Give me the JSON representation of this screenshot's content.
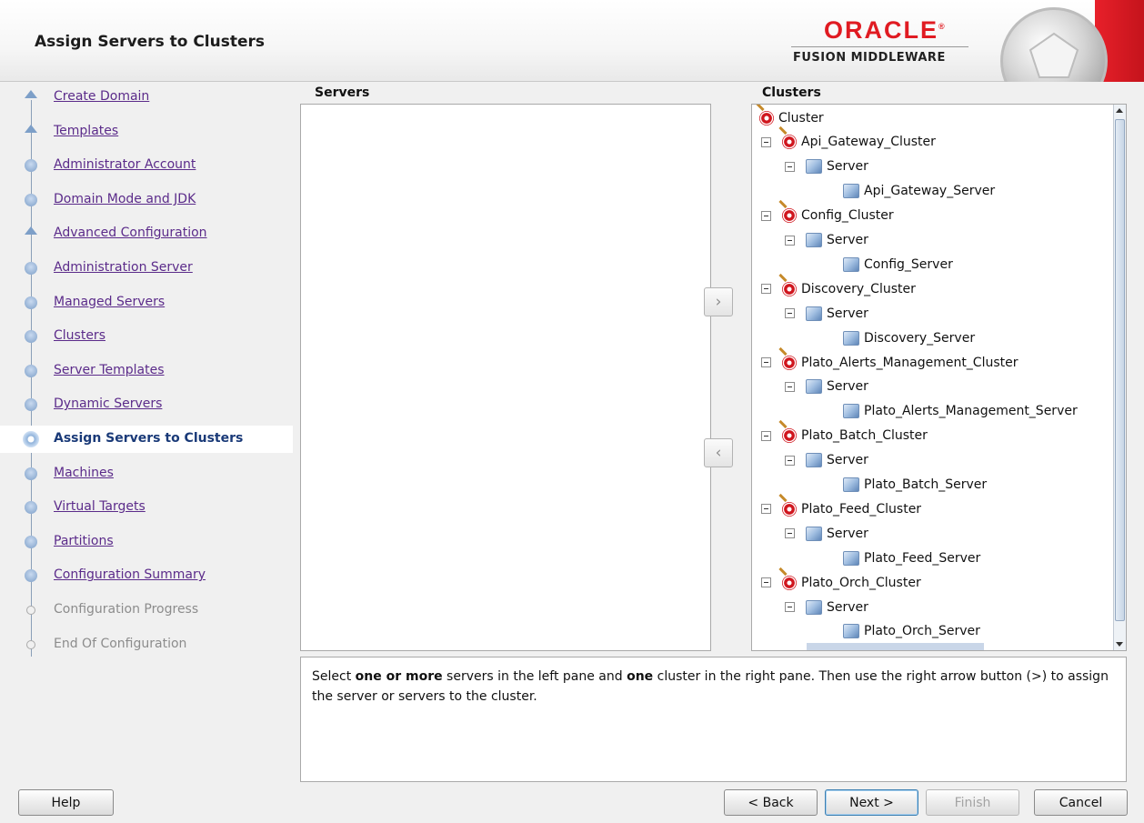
{
  "header": {
    "title": "Assign Servers to Clusters",
    "brand_oracle": "ORACLE",
    "brand_registered": "®",
    "brand_product": "FUSION MIDDLEWARE"
  },
  "nav": {
    "items": [
      {
        "label": "Create Domain",
        "state": "done"
      },
      {
        "label": "Templates",
        "state": "done"
      },
      {
        "label": "Administrator Account",
        "state": "done"
      },
      {
        "label": "Domain Mode and JDK",
        "state": "done"
      },
      {
        "label": "Advanced Configuration",
        "state": "done"
      },
      {
        "label": "Administration Server",
        "state": "done"
      },
      {
        "label": "Managed Servers",
        "state": "done"
      },
      {
        "label": "Clusters",
        "state": "done"
      },
      {
        "label": "Server Templates",
        "state": "done"
      },
      {
        "label": "Dynamic Servers",
        "state": "done"
      },
      {
        "label": "Assign Servers to Clusters",
        "state": "current"
      },
      {
        "label": "Machines",
        "state": "done"
      },
      {
        "label": "Virtual Targets",
        "state": "done"
      },
      {
        "label": "Partitions",
        "state": "done"
      },
      {
        "label": "Configuration Summary",
        "state": "done"
      },
      {
        "label": "Configuration Progress",
        "state": "disabled"
      },
      {
        "label": "End Of Configuration",
        "state": "disabled"
      }
    ]
  },
  "servers_pane": {
    "heading": "Servers",
    "items": []
  },
  "clusters_pane": {
    "heading": "Clusters",
    "tree": [
      {
        "type": "root",
        "label": "Cluster"
      },
      {
        "type": "cluster",
        "label": "Api_Gateway_Cluster"
      },
      {
        "type": "server-group",
        "label": "Server"
      },
      {
        "type": "server",
        "label": "Api_Gateway_Server"
      },
      {
        "type": "cluster",
        "label": "Config_Cluster"
      },
      {
        "type": "server-group",
        "label": "Server"
      },
      {
        "type": "server",
        "label": "Config_Server"
      },
      {
        "type": "cluster",
        "label": "Discovery_Cluster"
      },
      {
        "type": "server-group",
        "label": "Server"
      },
      {
        "type": "server",
        "label": "Discovery_Server"
      },
      {
        "type": "cluster",
        "label": "Plato_Alerts_Management_Cluster"
      },
      {
        "type": "server-group",
        "label": "Server"
      },
      {
        "type": "server",
        "label": "Plato_Alerts_Management_Server"
      },
      {
        "type": "cluster",
        "label": "Plato_Batch_Cluster"
      },
      {
        "type": "server-group",
        "label": "Server"
      },
      {
        "type": "server",
        "label": "Plato_Batch_Server"
      },
      {
        "type": "cluster",
        "label": "Plato_Feed_Cluster"
      },
      {
        "type": "server-group",
        "label": "Server"
      },
      {
        "type": "server",
        "label": "Plato_Feed_Server"
      },
      {
        "type": "cluster",
        "label": "Plato_Orch_Cluster"
      },
      {
        "type": "server-group",
        "label": "Server"
      },
      {
        "type": "server",
        "label": "Plato_Orch_Server"
      }
    ]
  },
  "move_buttons": {
    "assign": "›",
    "unassign": "‹"
  },
  "description": {
    "part1": "Select ",
    "bold1": "one or more",
    "part2": " servers in the left pane and ",
    "bold2": "one",
    "part3": " cluster in the right pane. Then use the right arrow button (>) to assign the server or servers to the cluster."
  },
  "footer": {
    "help": "Help",
    "back": "< Back",
    "next": "Next >",
    "finish": "Finish",
    "cancel": "Cancel"
  },
  "icons": {
    "nav_done": "milestone-icon",
    "nav_current": "current-step-icon",
    "cluster": "cluster-target-icon",
    "server": "server-cube-icon",
    "collapse": "collapse-toggle-icon"
  },
  "colors": {
    "oracle_red": "#e01b22",
    "link_purple": "#5b2b8a",
    "active_blue": "#1a3a78"
  }
}
